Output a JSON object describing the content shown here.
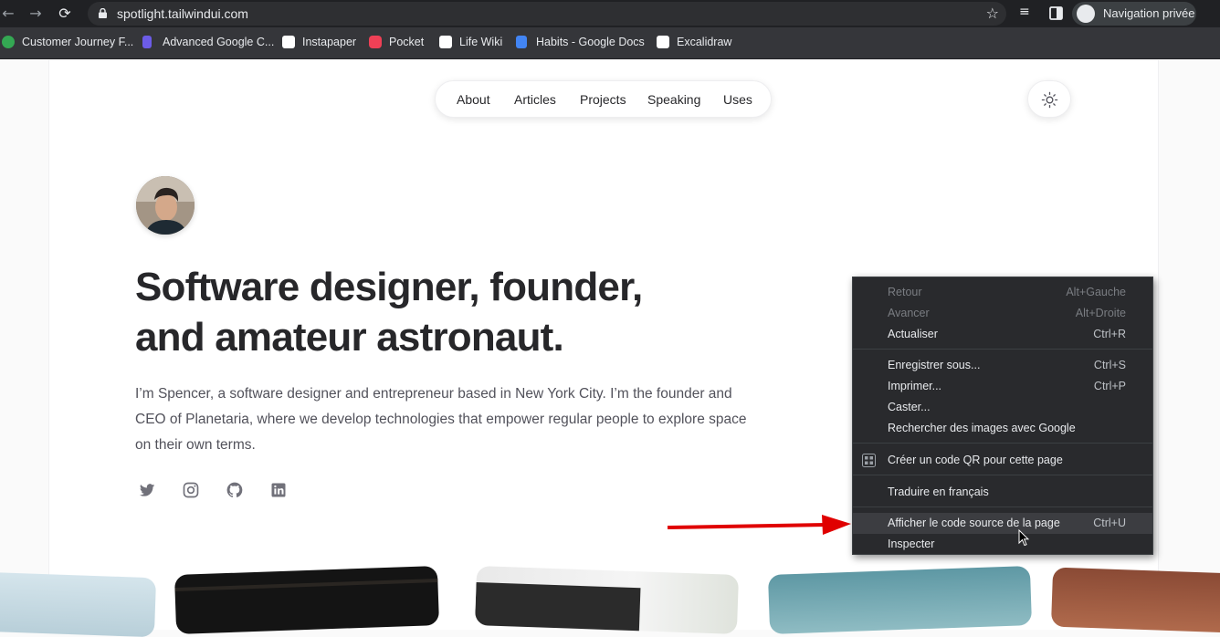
{
  "browser": {
    "url": "spotlight.tailwindui.com",
    "profile_label": "Navigation privée",
    "bookmarks": [
      {
        "label": "Customer Journey F...",
        "color": "#34a853"
      },
      {
        "label": "Advanced Google C...",
        "color": "#6c5ce7"
      },
      {
        "label": "Instapaper",
        "color": "#ffffff"
      },
      {
        "label": "Pocket",
        "color": "#ef4056"
      },
      {
        "label": "Life Wiki",
        "color": "#ffffff"
      },
      {
        "label": "Habits - Google Docs",
        "color": "#4285f4"
      },
      {
        "label": "Excalidraw",
        "color": "#ffffff"
      }
    ]
  },
  "site": {
    "nav": [
      "About",
      "Articles",
      "Projects",
      "Speaking",
      "Uses"
    ],
    "headline_line1": "Software designer, founder,",
    "headline_line2": "and amateur astronaut.",
    "intro": "I’m Spencer, a software designer and entrepreneur based in New York City. I’m the founder and CEO of Planetaria, where we develop technologies that empower regular people to explore space on their own terms.",
    "social": [
      "twitter-icon",
      "instagram-icon",
      "github-icon",
      "linkedin-icon"
    ]
  },
  "context_menu": {
    "items": [
      {
        "label": "Retour",
        "shortcut": "Alt+Gauche",
        "disabled": true
      },
      {
        "label": "Avancer",
        "shortcut": "Alt+Droite",
        "disabled": true
      },
      {
        "label": "Actualiser",
        "shortcut": "Ctrl+R"
      },
      {
        "label": "Enregistrer sous...",
        "shortcut": "Ctrl+S"
      },
      {
        "label": "Imprimer...",
        "shortcut": "Ctrl+P"
      },
      {
        "label": "Caster...",
        "shortcut": ""
      },
      {
        "label": "Rechercher des images avec Google",
        "shortcut": ""
      },
      {
        "label": "Créer un code QR pour cette page",
        "shortcut": ""
      },
      {
        "label": "Traduire en français",
        "shortcut": ""
      },
      {
        "label": "Afficher le code source de la page",
        "shortcut": "Ctrl+U",
        "highlighted": true
      },
      {
        "label": "Inspecter",
        "shortcut": ""
      }
    ]
  },
  "colors": {
    "annotation_arrow": "#e00000",
    "text_primary": "#27272a",
    "text_muted": "#52525b"
  }
}
